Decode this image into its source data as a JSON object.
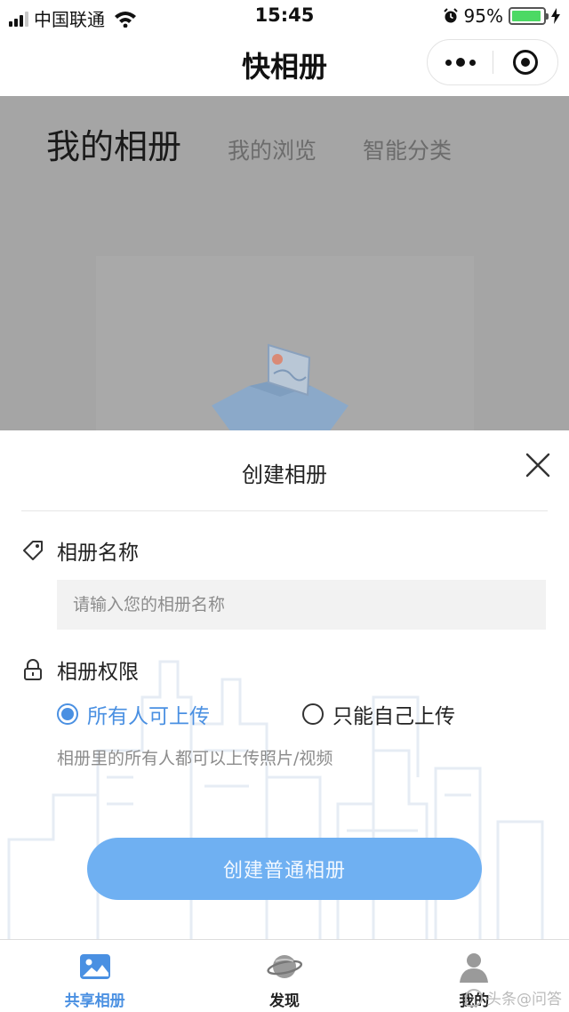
{
  "status_bar": {
    "carrier": "中国联通",
    "time": "15:45",
    "battery": "95%",
    "battery_level": 0.95
  },
  "nav": {
    "title": "快相册"
  },
  "background_page": {
    "tabs": [
      "我的相册",
      "我的浏览",
      "智能分类"
    ],
    "active_tab": "我的相册"
  },
  "modal": {
    "title": "创建相册",
    "name_label": "相册名称",
    "name_placeholder": "请输入您的相册名称",
    "name_value": "",
    "permission_label": "相册权限",
    "options": [
      "所有人可上传",
      "只能自己上传"
    ],
    "selected_option": "所有人可上传",
    "hint": "相册里的所有人都可以上传照片/视频",
    "create_button": "创建普通相册"
  },
  "tab_bar": {
    "items": [
      {
        "label": "共享相册",
        "icon": "image-icon",
        "active": true
      },
      {
        "label": "发现",
        "icon": "planet-icon",
        "active": false
      },
      {
        "label": "我的",
        "icon": "user-icon",
        "active": false
      }
    ],
    "watermark": "头条@问答"
  },
  "colors": {
    "accent": "#4a90e2",
    "button": "#6fb0f2",
    "overlay": "#a5a5a5"
  }
}
